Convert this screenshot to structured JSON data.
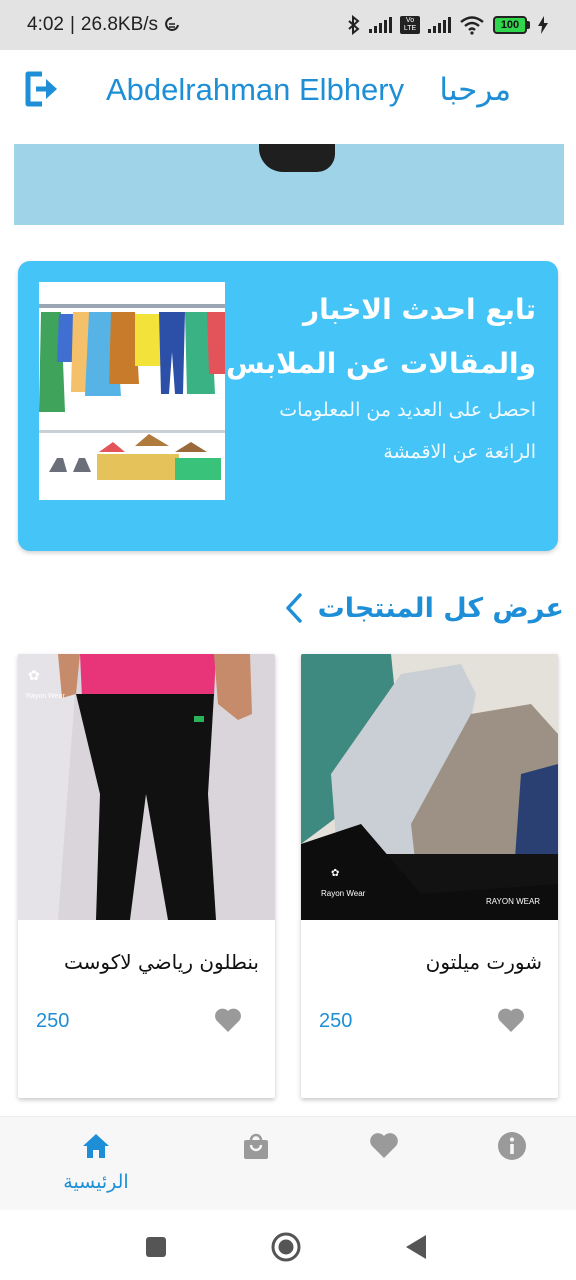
{
  "status_bar": {
    "time": "4:02",
    "separator": "|",
    "net_speed": "26.8KB/s",
    "battery_level": "100",
    "volte_label": "Vo LTE"
  },
  "header": {
    "greeting": "مرحبا",
    "user_name": "Abdelrahman Elbhery",
    "accent_color": "#1e8fd6"
  },
  "news_card": {
    "title_line1": "تابع احدث الاخبار",
    "title_line2": "والمقالات عن الملابس",
    "subtitle_line1": "احصل على العديد من المعلومات",
    "subtitle_line2": "الرائعة عن الاقمشة",
    "background_color": "#45c4f7"
  },
  "products_section": {
    "view_all_label": "عرض كل المنتجات",
    "chevron_icon": "chevron-left-icon"
  },
  "products": [
    {
      "name": "شورت ميلتون",
      "price": "250",
      "favorite_icon": "heart-icon",
      "image_brand": "Rayon Wear"
    },
    {
      "name": "بنطلون رياضي لاكوست",
      "price": "250",
      "favorite_icon": "heart-icon",
      "image_brand": "Rayon Wear"
    }
  ],
  "bottom_nav": {
    "items": [
      {
        "label": "الرئيسية",
        "icon": "home-icon",
        "active": true
      },
      {
        "label": "",
        "icon": "shopping-bag-icon",
        "active": false
      },
      {
        "label": "",
        "icon": "heart-icon",
        "active": false
      },
      {
        "label": "",
        "icon": "info-icon",
        "active": false
      }
    ]
  },
  "system_nav": {
    "buttons": [
      "recents-button",
      "home-button",
      "back-button"
    ]
  }
}
